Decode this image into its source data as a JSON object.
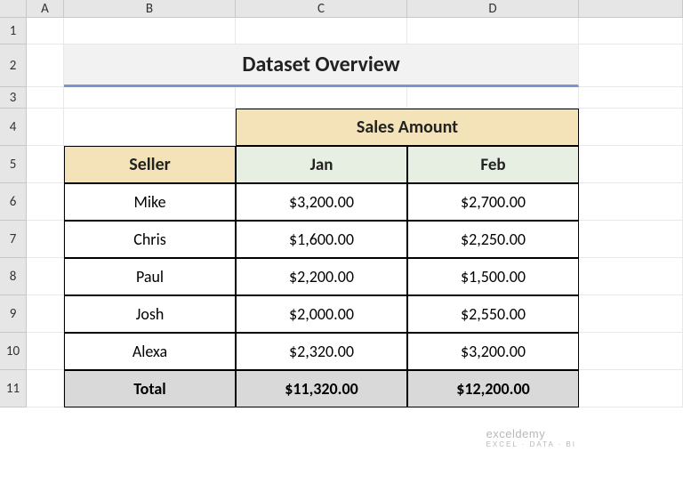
{
  "columns": [
    "A",
    "B",
    "C",
    "D"
  ],
  "rows": [
    "1",
    "2",
    "3",
    "4",
    "5",
    "6",
    "7",
    "8",
    "9",
    "10",
    "11"
  ],
  "title": "Dataset Overview",
  "headers": {
    "sales": "Sales Amount",
    "seller": "Seller",
    "jan": "Jan",
    "feb": "Feb",
    "total": "Total"
  },
  "data": [
    {
      "seller": "Mike",
      "jan": "$3,200.00",
      "feb": "$2,700.00"
    },
    {
      "seller": "Chris",
      "jan": "$1,600.00",
      "feb": "$2,250.00"
    },
    {
      "seller": "Paul",
      "jan": "$2,200.00",
      "feb": "$1,500.00"
    },
    {
      "seller": "Josh",
      "jan": "$2,000.00",
      "feb": "$2,550.00"
    },
    {
      "seller": "Alexa",
      "jan": "$2,320.00",
      "feb": "$3,200.00"
    }
  ],
  "totals": {
    "jan": "$11,320.00",
    "feb": "$12,200.00"
  },
  "watermark": {
    "main": "exceldemy",
    "sub": "EXCEL · DATA · BI"
  }
}
